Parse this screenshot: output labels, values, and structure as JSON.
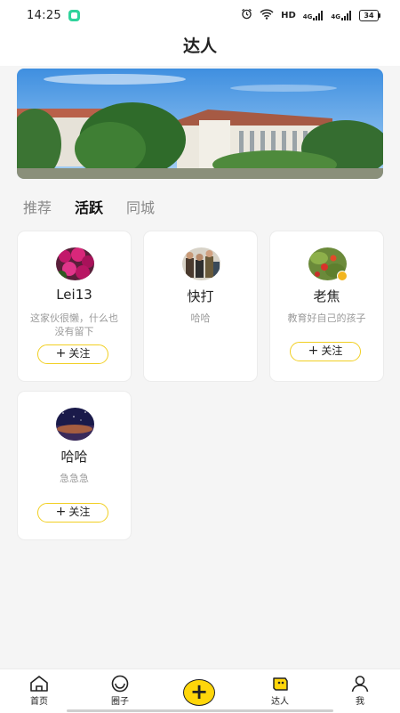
{
  "status_bar": {
    "time": "14:25",
    "network": "HD",
    "signal_1": "4G",
    "signal_2": "4G",
    "battery": "34"
  },
  "header": {
    "title": "达人"
  },
  "tabs": [
    {
      "label": "推荐",
      "active": false
    },
    {
      "label": "活跃",
      "active": true
    },
    {
      "label": "同城",
      "active": false
    }
  ],
  "users": [
    {
      "name": "Lei13",
      "bio": "这家伙很懒，什么也没有留下",
      "follow_label": "关注",
      "avatar": "flower-photo"
    },
    {
      "name": "快打",
      "bio": "哈哈",
      "follow_label": "",
      "avatar": "people-photo"
    },
    {
      "name": "老焦",
      "bio": "教育好自己的孩子",
      "follow_label": "关注",
      "avatar": "plant-photo"
    },
    {
      "name": "哈哈",
      "bio": "急急急",
      "follow_label": "关注",
      "avatar": "night-sky-photo"
    }
  ],
  "bottom_nav": [
    {
      "label": "首页",
      "icon": "home-icon"
    },
    {
      "label": "圈子",
      "icon": "circle-icon"
    },
    {
      "label": "",
      "icon": "plus-icon"
    },
    {
      "label": "达人",
      "icon": "expert-icon",
      "active": true
    },
    {
      "label": "我",
      "icon": "user-icon"
    }
  ],
  "colors": {
    "accent": "#ffd60a",
    "follow_border": "#f1cf22",
    "background": "#f5f5f5"
  }
}
